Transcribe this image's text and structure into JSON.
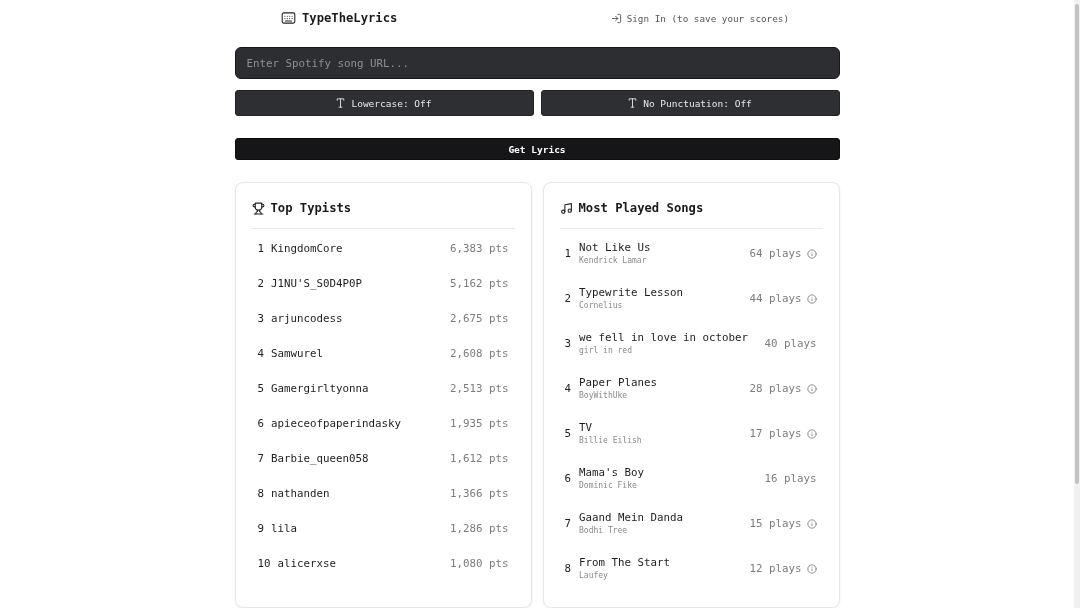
{
  "header": {
    "logo": "TypeTheLyrics",
    "sign_in": "Sign In (to save your scores)"
  },
  "url_field": {
    "placeholder": "Enter Spotify song URL..."
  },
  "toggles": [
    {
      "label": "Lowercase: Off"
    },
    {
      "label": "No Punctuation: Off"
    }
  ],
  "get_lyrics_button": "Get Lyrics",
  "top_typists": {
    "title": "Top Typists",
    "rows": [
      {
        "rank": "1",
        "name": "KingdomCore",
        "points": "6,383 pts"
      },
      {
        "rank": "2",
        "name": "J1NU'S_S0D4P0P",
        "points": "5,162 pts"
      },
      {
        "rank": "3",
        "name": "arjuncodess",
        "points": "2,675 pts"
      },
      {
        "rank": "4",
        "name": "Samwurel",
        "points": "2,608 pts"
      },
      {
        "rank": "5",
        "name": "Gamergirltyonna",
        "points": "2,513 pts"
      },
      {
        "rank": "6",
        "name": "apieceofpaperindasky",
        "points": "1,935 pts"
      },
      {
        "rank": "7",
        "name": "Barbie_queen058",
        "points": "1,612 pts"
      },
      {
        "rank": "8",
        "name": "nathanden",
        "points": "1,366 pts"
      },
      {
        "rank": "9",
        "name": "lila",
        "points": "1,286 pts"
      },
      {
        "rank": "10",
        "name": "alicerxse",
        "points": "1,080 pts"
      }
    ]
  },
  "most_played": {
    "title": "Most Played Songs",
    "rows": [
      {
        "rank": "1",
        "title": "Not Like Us",
        "artist": "Kendrick Lamar",
        "plays": "64 plays",
        "info": true
      },
      {
        "rank": "2",
        "title": "Typewrite Lesson",
        "artist": "Cornelius",
        "plays": "44 plays",
        "info": true
      },
      {
        "rank": "3",
        "title": "we fell in love in october",
        "artist": "girl in red",
        "plays": "40 plays",
        "info": false
      },
      {
        "rank": "4",
        "title": "Paper Planes",
        "artist": "BoyWithUke",
        "plays": "28 plays",
        "info": true
      },
      {
        "rank": "5",
        "title": "TV",
        "artist": "Billie Eilish",
        "plays": "17 plays",
        "info": true
      },
      {
        "rank": "6",
        "title": "Mama's Boy",
        "artist": "Dominic Fike",
        "plays": "16 plays",
        "info": false
      },
      {
        "rank": "7",
        "title": "Gaand Mein Danda",
        "artist": "Bodhi Tree",
        "plays": "15 plays",
        "info": true
      },
      {
        "rank": "8",
        "title": "From The Start",
        "artist": "Laufey",
        "plays": "12 plays",
        "info": true
      }
    ]
  }
}
